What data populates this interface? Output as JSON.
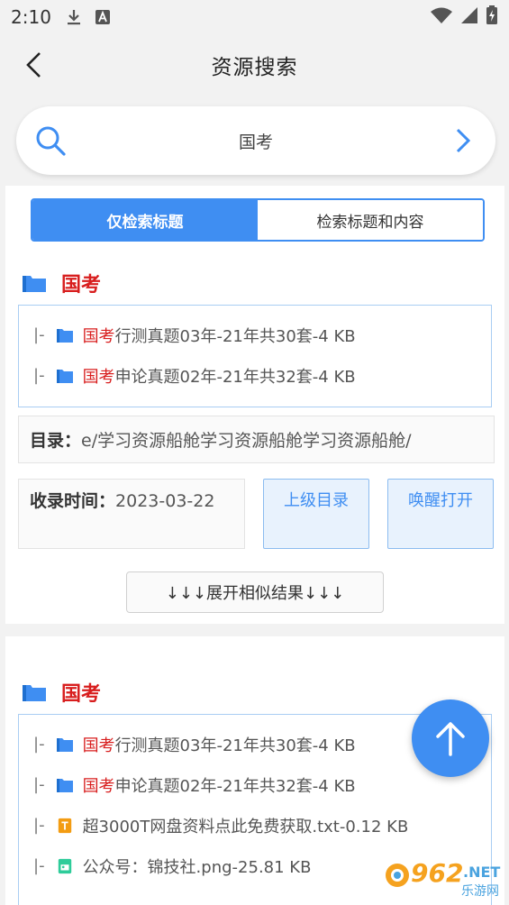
{
  "status_bar": {
    "time": "2:10"
  },
  "header": {
    "title": "资源搜索"
  },
  "search": {
    "query": "国考"
  },
  "tabs": [
    {
      "label": "仅检索标题",
      "active": true
    },
    {
      "label": "检索标题和内容",
      "active": false
    }
  ],
  "result1": {
    "group_name": "国考",
    "items": [
      {
        "prefix": "|-",
        "icon": "folder-icon",
        "keyword": "国考",
        "rest": "行测真题03年-21年共30套-4 KB"
      },
      {
        "prefix": "|-",
        "icon": "folder-icon",
        "keyword": "国考",
        "rest": "申论真题02年-21年共32套-4 KB"
      }
    ],
    "dir_label": "目录：",
    "dir_value": "e/学习资源船舱学习资源船舱学习资源船舱/",
    "time_label": "收录时间：",
    "time_value": "2023-03-22",
    "btn_up": "上级目录",
    "btn_wake": "唤醒打开",
    "expand": "↓↓↓展开相似结果↓↓↓"
  },
  "result2": {
    "group_name": "国考",
    "items": [
      {
        "prefix": "|-",
        "icon": "folder-icon",
        "keyword": "国考",
        "rest": "行测真题03年-21年共30套-4 KB"
      },
      {
        "prefix": "|-",
        "icon": "folder-icon",
        "keyword": "国考",
        "rest": "申论真题02年-21年共32套-4 KB"
      },
      {
        "prefix": "|-",
        "icon": "text-file-icon",
        "keyword": "",
        "rest": "超3000T网盘资料点此免费获取.txt-0.12 KB"
      },
      {
        "prefix": "|-",
        "icon": "image-file-icon",
        "keyword": "",
        "rest": "公众号：锦技社.png-25.81 KB"
      }
    ]
  },
  "watermark": {
    "number": "962",
    "net": ".NET",
    "site": "乐游网"
  },
  "colors": {
    "accent": "#3f8ef2",
    "keyword": "#d81e1e",
    "border": "#a9cdf3"
  }
}
